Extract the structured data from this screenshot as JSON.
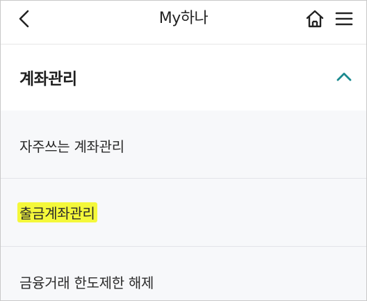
{
  "header": {
    "title": "My하나",
    "back_icon": "chevron-left-icon",
    "home_icon": "home-icon",
    "menu_icon": "hamburger-menu-icon"
  },
  "section": {
    "title": "계좌관리",
    "expanded": true,
    "toggle_icon": "chevron-up-icon",
    "accent_color": "#1a8a8f",
    "items": [
      {
        "label": "자주쓰는 계좌관리",
        "highlighted": false
      },
      {
        "label": "출금계좌관리",
        "highlighted": true
      },
      {
        "label": "금융거래 한도제한 해제",
        "highlighted": false
      }
    ]
  },
  "colors": {
    "highlight": "#f4f83a",
    "sub_background": "#f7f8fa"
  }
}
